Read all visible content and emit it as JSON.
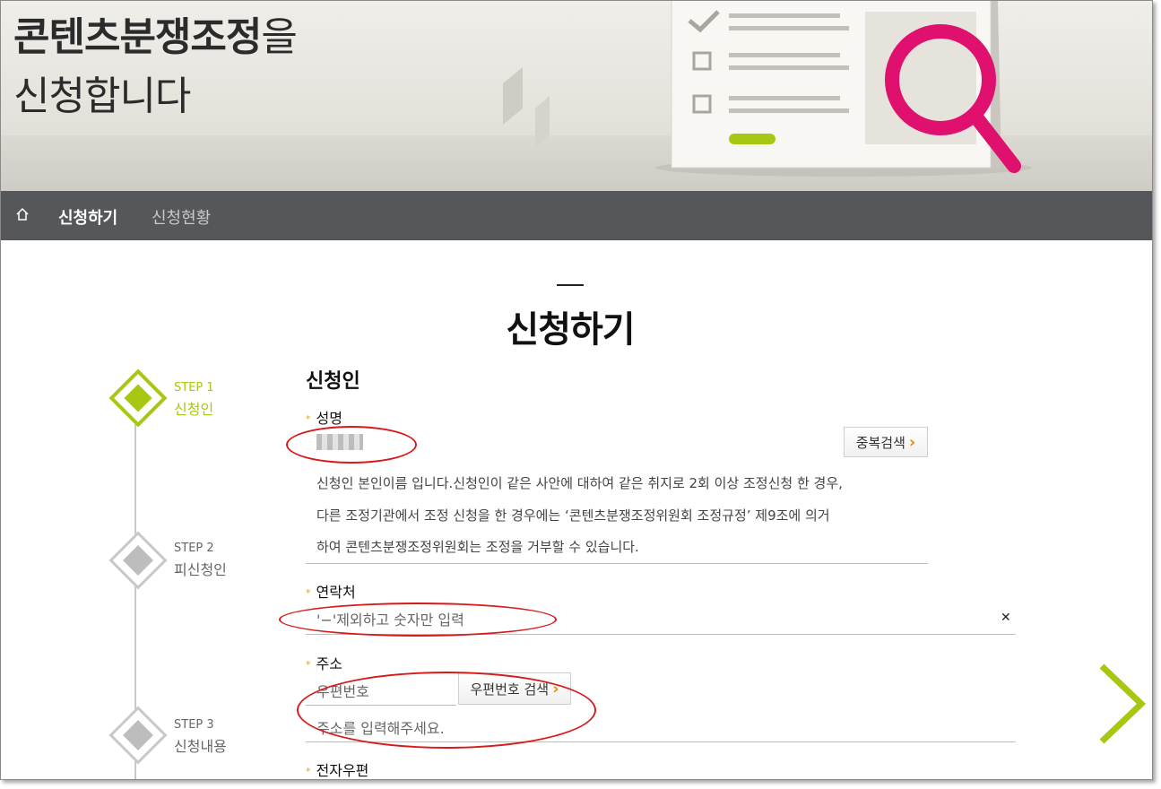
{
  "hero": {
    "title_bold": "콘텐츠분쟁조정",
    "title_light": "을",
    "title_line2": "신청합니다"
  },
  "nav": {
    "home_icon": "home-icon",
    "items": [
      {
        "label": "신청하기",
        "active": true
      },
      {
        "label": "신청현황",
        "active": false
      }
    ]
  },
  "page_title": "신청하기",
  "steps": [
    {
      "step": "STEP 1",
      "label": "신청인",
      "active": true,
      "color": "#a6c813"
    },
    {
      "step": "STEP 2",
      "label": "피신청인",
      "active": false
    },
    {
      "step": "STEP 3",
      "label": "신청내용",
      "active": false
    }
  ],
  "form": {
    "section_title": "신청인",
    "name": {
      "label": "성명",
      "dup_button": "중복검색",
      "note_line1": "신청인 본인이름 입니다.신청인이 같은 사안에 대하여 같은 취지로 2회 이상 조정신청 한 경우,",
      "note_line2": "다른 조정기관에서 조정 신청을 한 경우에는 ‘콘텐츠분쟁조정위원회 조정규정’ 제9조에 의거",
      "note_line3": "하여 콘텐츠분쟁조정위원회는 조정을 거부할 수 있습니다."
    },
    "contact": {
      "label": "연락처",
      "placeholder": "'−'제외하고 숫자만 입력",
      "clear_icon": "close-icon"
    },
    "address": {
      "label": "주소",
      "zip_placeholder": "우편번호",
      "zip_button": "우편번호 검색",
      "address_placeholder": "주소를 입력해주세요."
    },
    "email": {
      "label": "전자우편"
    }
  },
  "colors": {
    "accent_green": "#a6c813",
    "required_marker": "#f0a000",
    "nav_bg": "#55575b",
    "annotation_red": "#d71a1a",
    "magnifier_pink": "#e0106e"
  }
}
